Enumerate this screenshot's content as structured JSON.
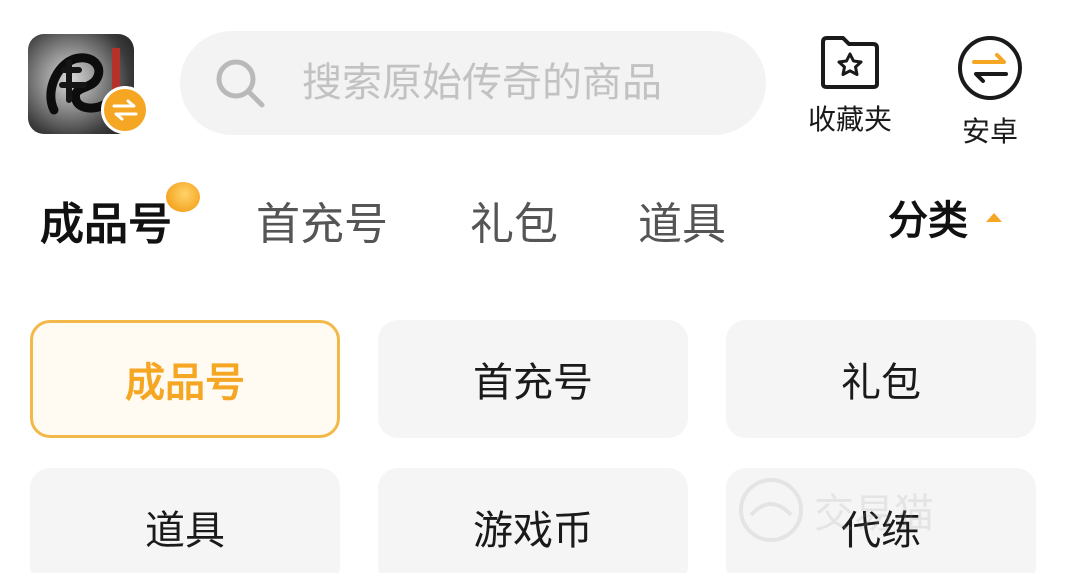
{
  "header": {
    "app_icon_name": "dragon-game-icon",
    "search": {
      "placeholder": "搜索原始传奇的商品"
    },
    "favorites_label": "收藏夹",
    "android_label": "安卓"
  },
  "tabs": {
    "items": [
      {
        "label": "成品号",
        "active": true
      },
      {
        "label": "首充号",
        "active": false
      },
      {
        "label": "礼包",
        "active": false
      },
      {
        "label": "道具",
        "active": false
      }
    ],
    "category_label": "分类"
  },
  "grid": {
    "items": [
      {
        "label": "成品号",
        "selected": true
      },
      {
        "label": "首充号",
        "selected": false
      },
      {
        "label": "礼包",
        "selected": false
      },
      {
        "label": "道具",
        "selected": false
      },
      {
        "label": "游戏币",
        "selected": false
      },
      {
        "label": "代练",
        "selected": false
      }
    ]
  },
  "watermark": {
    "text": "交易猫"
  },
  "colors": {
    "accent": "#f5a623",
    "selected_border": "#f2b84a",
    "item_bg": "#f5f5f5",
    "search_bg": "#f3f3f3"
  }
}
